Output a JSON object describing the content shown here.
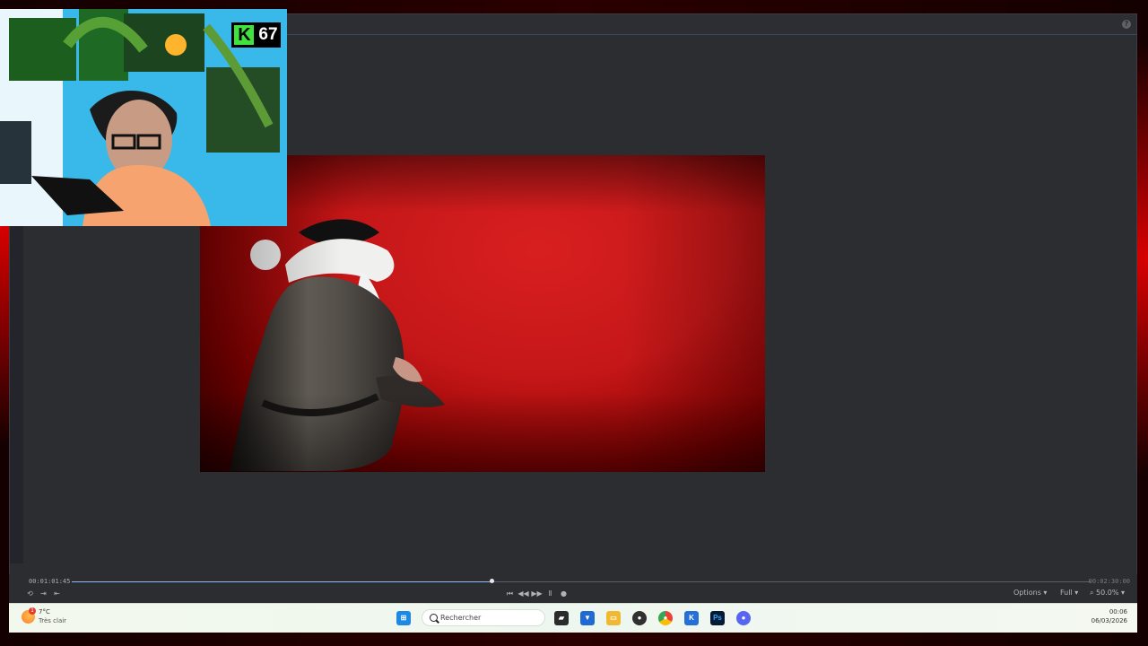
{
  "webcam": {
    "badge_count": "67",
    "badge_letter": "K"
  },
  "timeline": {
    "current_time": "00:01:01:45",
    "total_time": "00:02:30:00",
    "progress_fraction": 0.415
  },
  "viewer_controls": {
    "options_label": "Options ▾",
    "quality_label": "Full ▾",
    "zoom_label": "50.0% ▾"
  },
  "taskbar": {
    "weather_temp": "7°C",
    "weather_desc": "Très clair",
    "weather_alert": "1",
    "search_placeholder": "Rechercher",
    "photoshop_label": "Ps",
    "time": "00:06",
    "date": "06/03/2026"
  },
  "colors": {
    "accent": "#8fb7ff",
    "red_background": "#c51718",
    "webcam_badge_green": "#40e33c"
  },
  "icons": [
    "help-icon",
    "windows-start-icon",
    "search-icon",
    "task-view-icon",
    "vs-code-icon",
    "file-explorer-icon",
    "obs-icon",
    "chrome-icon",
    "kdenlive-icon",
    "photoshop-icon",
    "discord-icon"
  ]
}
